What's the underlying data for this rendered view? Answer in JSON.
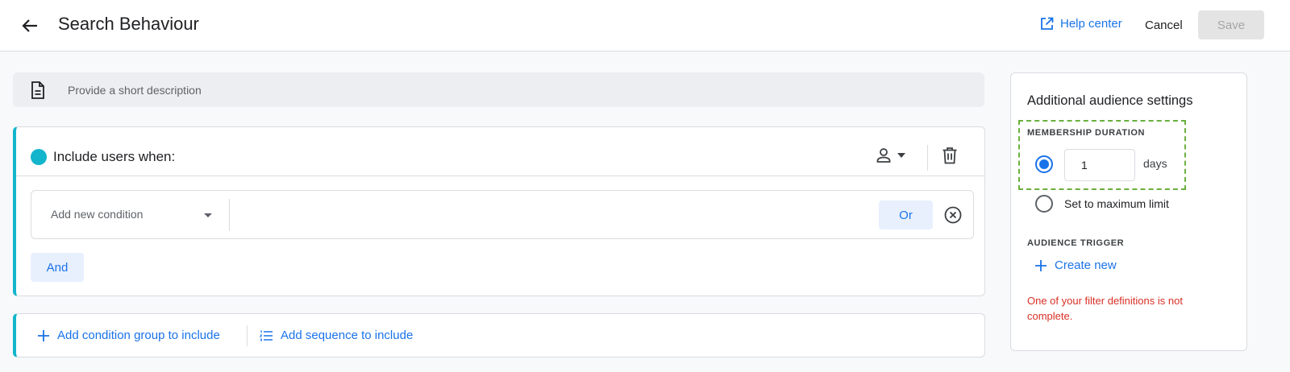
{
  "header": {
    "title": "Search Behaviour",
    "help_label": "Help center",
    "cancel_label": "Cancel",
    "save_label": "Save"
  },
  "description": {
    "placeholder": "Provide a short description"
  },
  "condition_group": {
    "title": "Include users when:",
    "condition_placeholder": "Add new condition",
    "or_label": "Or",
    "and_label": "And",
    "accent_color": "#12b5cb"
  },
  "add_actions": {
    "add_group_label": "Add condition group to include",
    "add_sequence_label": "Add sequence to include"
  },
  "settings": {
    "title": "Additional audience settings",
    "membership_label": "MEMBERSHIP DURATION",
    "duration_value": "1",
    "duration_unit": "days",
    "max_limit_label": "Set to maximum limit",
    "trigger_label": "AUDIENCE TRIGGER",
    "create_new_label": "Create new",
    "error_text": "One of your filter definitions is not complete.",
    "error_color": "#d93025"
  },
  "icons": {
    "back": "arrow-left-icon",
    "help": "open-in-new-icon",
    "description": "document-icon",
    "scope": "person-icon",
    "delete": "trash-icon",
    "remove": "close-circle-icon",
    "add": "plus-icon",
    "sequence": "list-numbered-icon"
  },
  "accent_color": "#1a73e8"
}
